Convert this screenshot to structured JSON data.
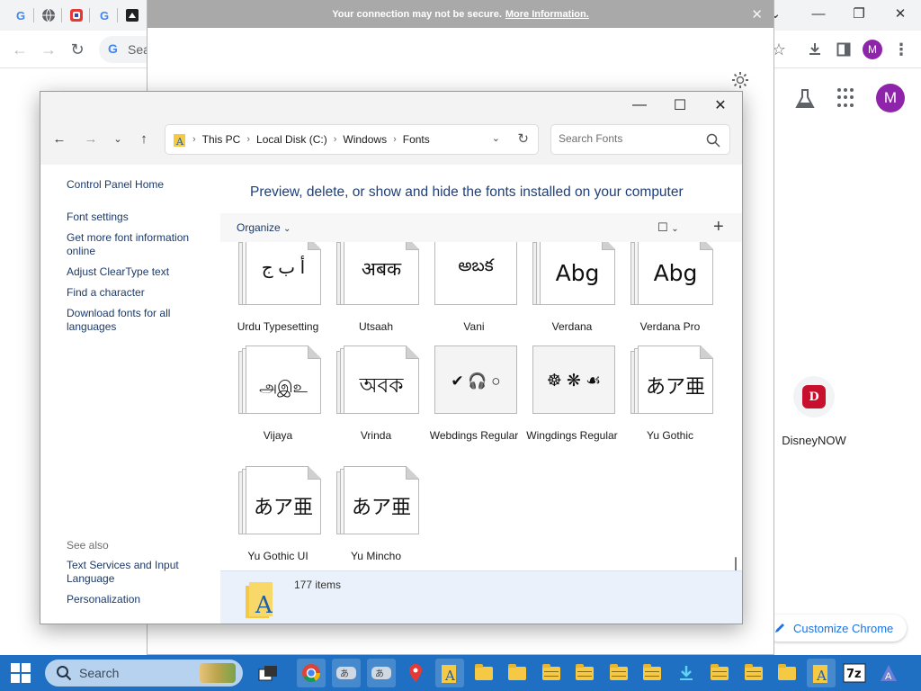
{
  "ff_banner": {
    "message": "Your connection may not be secure.",
    "link": "More Information."
  },
  "chrome": {
    "omnibox_text": "Sea",
    "avatar_letter": "M",
    "shortcut_label": "DisneyNOW",
    "customize_label": "Customize Chrome"
  },
  "explorer": {
    "breadcrumb": [
      "This PC",
      "Local Disk (C:)",
      "Windows",
      "Fonts"
    ],
    "search_placeholder": "Search Fonts",
    "heading": "Preview, delete, or show and hide the fonts installed on your computer",
    "organize_label": "Organize",
    "left_links": [
      "Control Panel Home",
      "Font settings",
      "Get more font information online",
      "Adjust ClearType text",
      "Find a character",
      "Download fonts for all languages"
    ],
    "see_also_label": "See also",
    "see_also_links": [
      "Text Services and Input Language",
      "Personalization"
    ],
    "fonts": [
      {
        "name": "Urdu Typesetting",
        "sample": "أ ب ج"
      },
      {
        "name": "Utsaah",
        "sample": "अबक"
      },
      {
        "name": "Vani",
        "sample": "అబక"
      },
      {
        "name": "Verdana",
        "sample": "Abg"
      },
      {
        "name": "Verdana Pro",
        "sample": "Abg"
      },
      {
        "name": "Vijaya",
        "sample": "அஇஉ"
      },
      {
        "name": "Vrinda",
        "sample": "অবক"
      },
      {
        "name": "Webdings Regular",
        "sample": "✔ 🎧 ○"
      },
      {
        "name": "Wingdings Regular",
        "sample": "☸ ❋ ☙"
      },
      {
        "name": "Yu Gothic",
        "sample": "あア亜"
      },
      {
        "name": "Yu Gothic UI",
        "sample": "あア亜"
      },
      {
        "name": "Yu Mincho",
        "sample": "あア亜"
      }
    ],
    "item_count": "177 items"
  },
  "taskbar": {
    "search_placeholder": "Search"
  }
}
